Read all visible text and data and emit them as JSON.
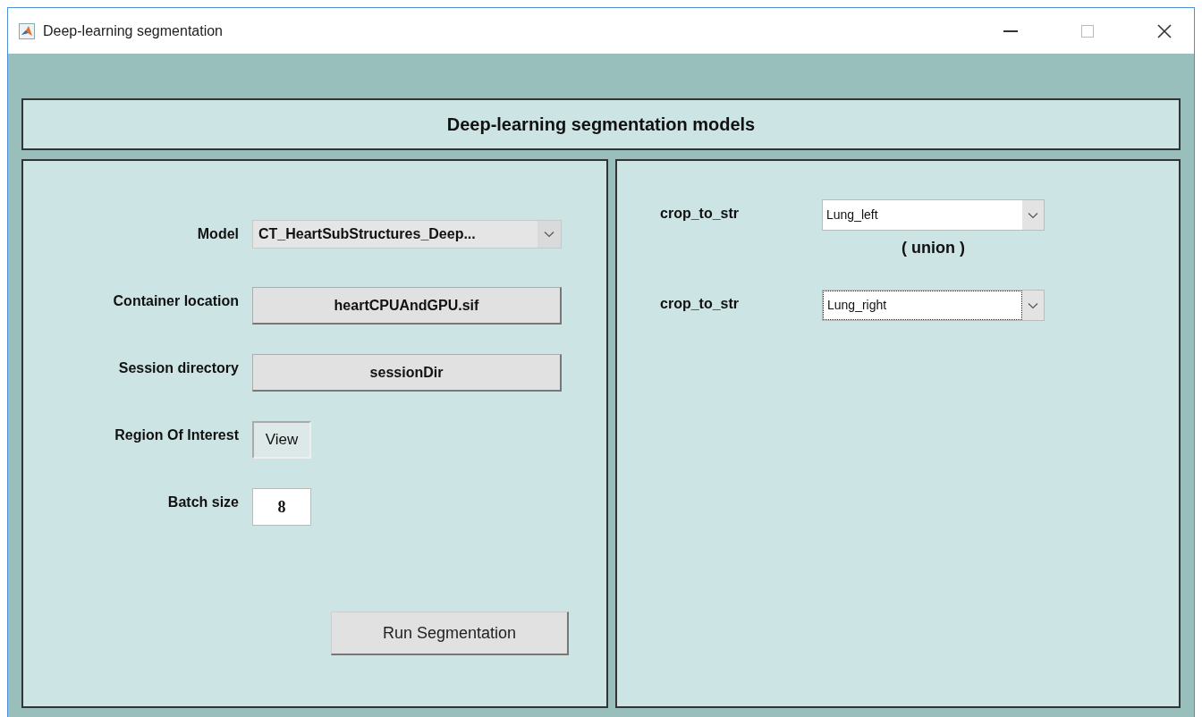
{
  "window": {
    "title": "Deep-learning segmentation"
  },
  "header": {
    "title": "Deep-learning segmentation models"
  },
  "settings": [
    {
      "kind": "dropdown",
      "label": "Model",
      "value": "CT_HeartSubStructures_Deep..."
    },
    {
      "kind": "button",
      "label": "Container location",
      "value": "heartCPUAndGPU.sif"
    },
    {
      "kind": "button",
      "label": "Session directory",
      "value": "sessionDir"
    },
    {
      "kind": "small_button",
      "label": "Region Of Interest",
      "value": "View"
    },
    {
      "kind": "input",
      "label": "Batch size",
      "value": "8"
    }
  ],
  "run_button": "Run Segmentation",
  "crop": [
    {
      "label": "crop_to_str",
      "value": "Lung_left",
      "focused": false
    },
    {
      "label": "crop_to_str",
      "value": "Lung_right",
      "focused": true
    }
  ],
  "operator": "( union )"
}
